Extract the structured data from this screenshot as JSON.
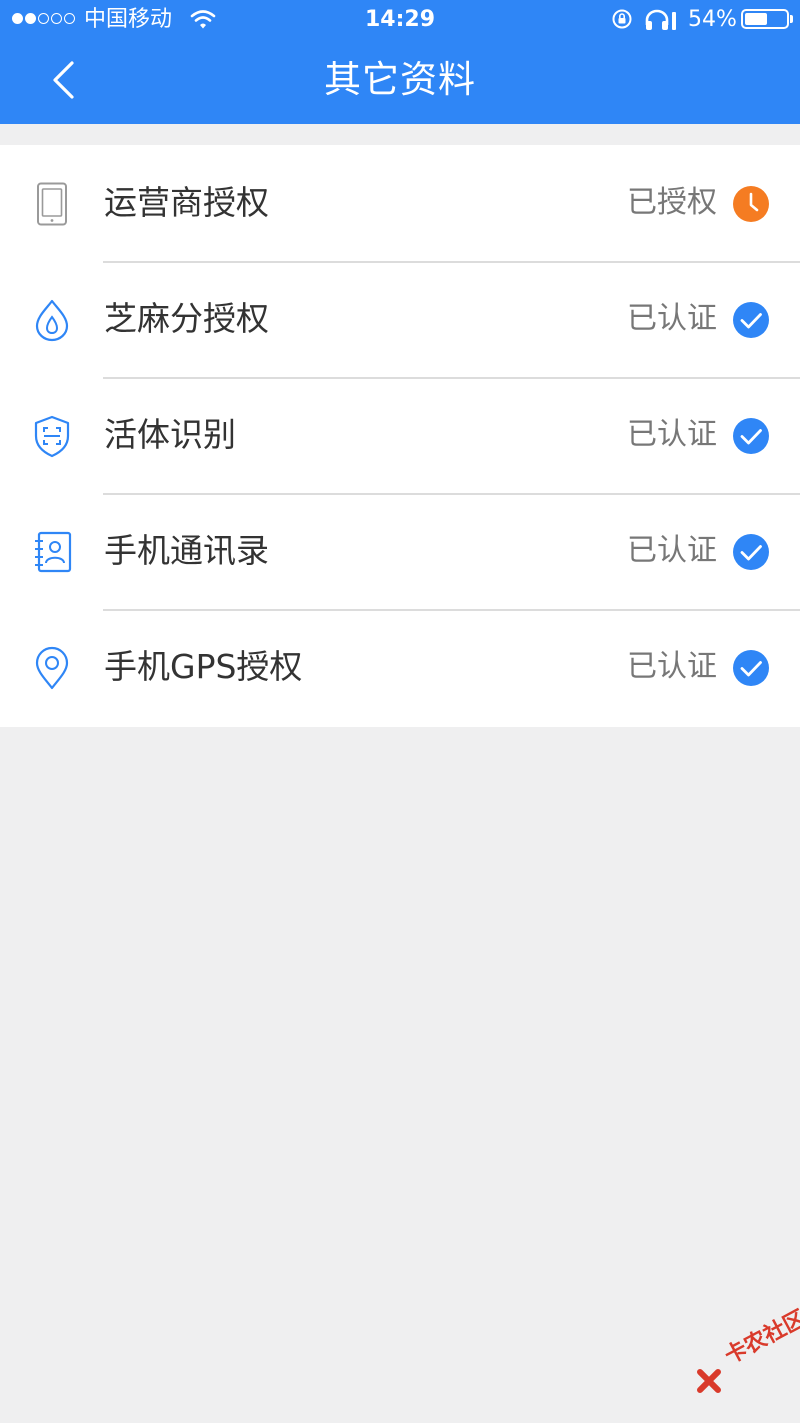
{
  "status_bar": {
    "signal_strength": 2,
    "signal_total": 5,
    "carrier": "中国移动",
    "time": "14:29",
    "battery_text": "54%",
    "battery_level": 0.54
  },
  "nav": {
    "title": "其它资料",
    "back_icon": "chevron-left-icon"
  },
  "items": [
    {
      "label": "运营商授权",
      "status": "已授权",
      "icon": "phone-icon",
      "badge": "clock-icon",
      "badge_color": "#f57c22"
    },
    {
      "label": "芝麻分授权",
      "status": "已认证",
      "icon": "sesame-drop-icon",
      "badge": "check-icon",
      "badge_color": "#2f86f6"
    },
    {
      "label": "活体识别",
      "status": "已认证",
      "icon": "face-scan-shield-icon",
      "badge": "check-icon",
      "badge_color": "#2f86f6"
    },
    {
      "label": "手机通讯录",
      "status": "已认证",
      "icon": "contacts-book-icon",
      "badge": "check-icon",
      "badge_color": "#2f86f6"
    },
    {
      "label": "手机GPS授权",
      "status": "已认证",
      "icon": "location-pin-icon",
      "badge": "check-icon",
      "badge_color": "#2f86f6"
    }
  ],
  "colors": {
    "primary": "#2f86f6",
    "pending": "#f57c22",
    "background": "#efeff0",
    "label": "#333333",
    "status": "#777777",
    "icon_gray": "#9a9a9a"
  },
  "watermark": {
    "text": "卡农社区"
  }
}
